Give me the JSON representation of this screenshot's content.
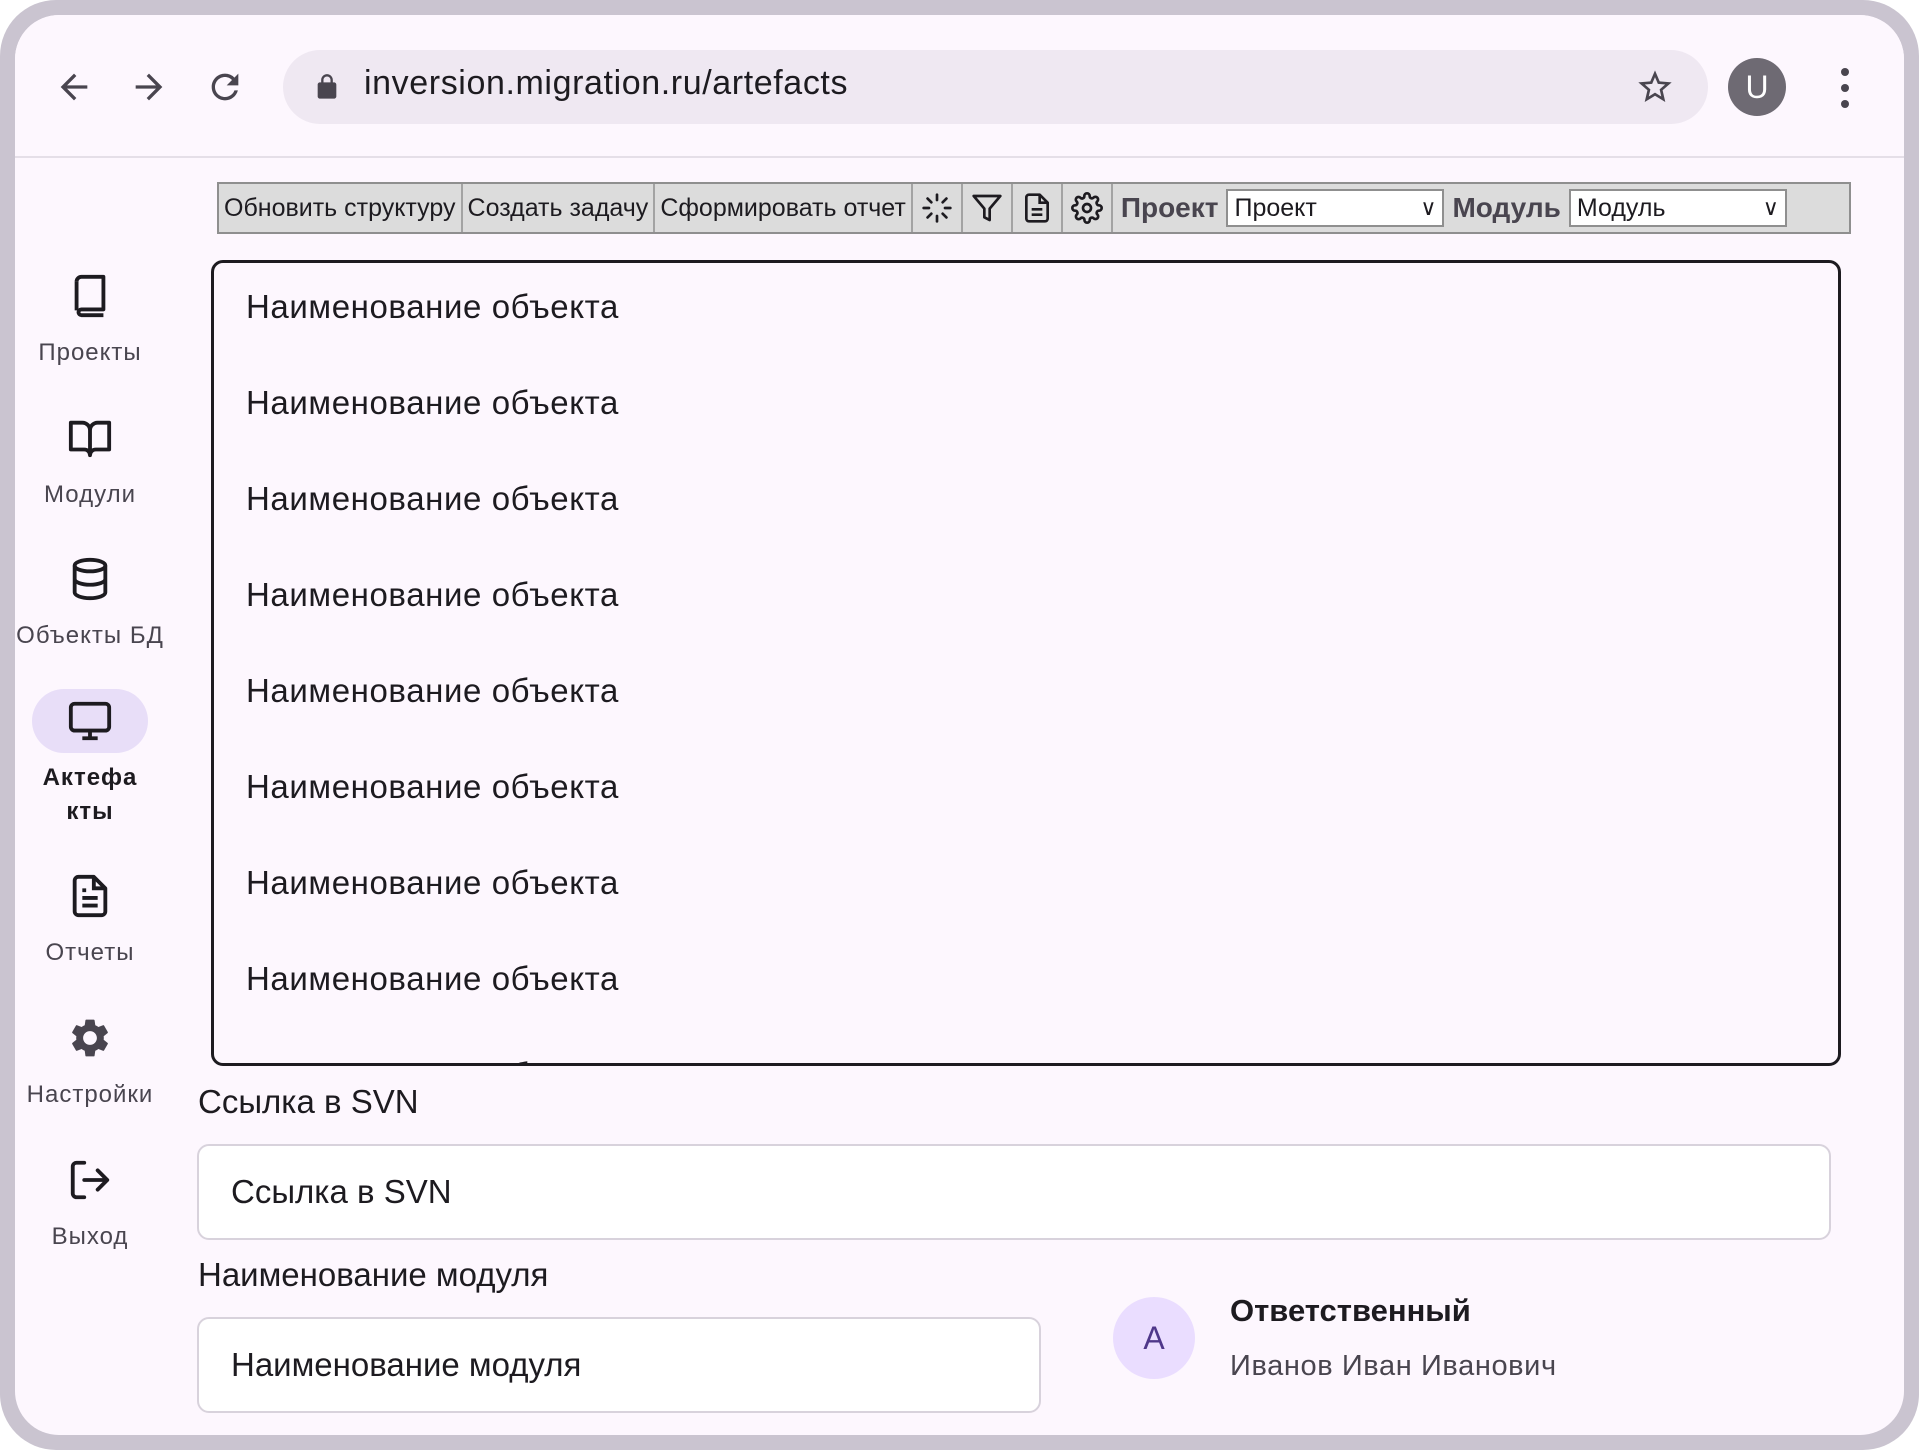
{
  "browser": {
    "url": "inversion.migration.ru/artefacts",
    "profile_initial": "U",
    "icons": [
      "back-arrow-icon",
      "forward-arrow-icon",
      "reload-icon",
      "lock-icon",
      "star-icon",
      "more-vert-icon"
    ]
  },
  "sidebar": {
    "items": [
      {
        "label": "Проекты",
        "icon": "book-icon",
        "active": false
      },
      {
        "label": "Модули",
        "icon": "open-book-icon",
        "active": false
      },
      {
        "label": "Объекты БД",
        "icon": "database-icon",
        "active": false
      },
      {
        "label": "Актефакты",
        "icon": "monitor-icon",
        "active": true
      },
      {
        "label": "Отчеты",
        "icon": "document-icon",
        "active": false
      },
      {
        "label": "Настройки",
        "icon": "gear-icon",
        "active": false
      },
      {
        "label": "Выход",
        "icon": "logout-icon",
        "active": false
      }
    ]
  },
  "toolbar": {
    "refresh_label": "Обновить структуру",
    "create_task_label": "Создать задачу",
    "report_label": "Сформировать отчет",
    "project_label": "Проект",
    "project_value": "Проект",
    "module_label": "Модуль",
    "module_value": "Модуль",
    "icons": [
      "loading-icon",
      "filter-icon",
      "document-icon",
      "settings-icon"
    ]
  },
  "list": {
    "items": [
      "Наименование объекта",
      "Наименование объекта",
      "Наименование объекта",
      "Наименование объекта",
      "Наименование объекта",
      "Наименование объекта",
      "Наименование объекта",
      "Наименование объекта",
      "Наименование объекта"
    ]
  },
  "form": {
    "svn_label": "Ссылка в SVN",
    "svn_placeholder": "Ссылка в SVN",
    "module_name_label": "Наименование модуля",
    "module_name_placeholder": "Наименование модуля"
  },
  "responsible": {
    "avatar_initial": "A",
    "title": "Ответственный",
    "name": "Иванов Иван Иванович"
  },
  "colors": {
    "background": "#fdf7fe",
    "active_nav": "#e8def8",
    "avatar_bg": "#eaddff",
    "avatar_fg": "#4f378a",
    "profile_bg": "#6e6a73",
    "toolbar_bg": "#dcdcdc"
  }
}
